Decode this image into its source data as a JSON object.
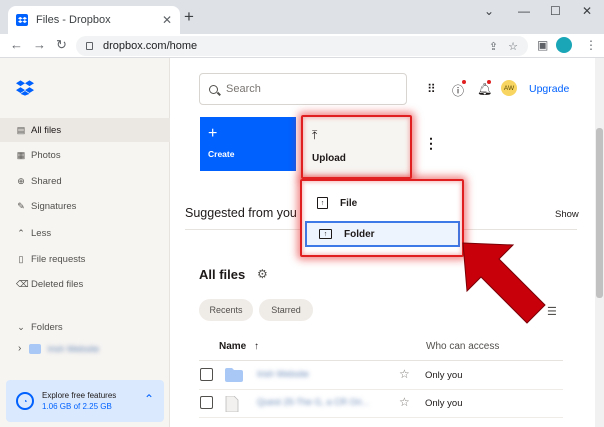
{
  "browser": {
    "tab_title": "Files - Dropbox",
    "tab_close": "✕",
    "new_tab": "+",
    "url": "dropbox.com/home",
    "window_controls": [
      "⌄",
      "—",
      "☐",
      "✕"
    ]
  },
  "sidebar": {
    "items": [
      {
        "label": "All files",
        "icon": "files-icon",
        "glyph": "▤"
      },
      {
        "label": "Photos",
        "icon": "photos-icon",
        "glyph": "▦"
      },
      {
        "label": "Shared",
        "icon": "shared-icon",
        "glyph": "⊕"
      },
      {
        "label": "Signatures",
        "icon": "signatures-icon",
        "glyph": "✎"
      },
      {
        "label": "Less",
        "icon": "chevron-up-icon",
        "glyph": "⌃"
      },
      {
        "label": "File requests",
        "icon": "file-requests-icon",
        "glyph": "▯"
      },
      {
        "label": "Deleted files",
        "icon": "trash-icon",
        "glyph": "⌫"
      }
    ],
    "folders_label": "Folders",
    "folders_chevron": "⌄",
    "folder_sub": "Irish Website",
    "storage": {
      "title": "Explore free features",
      "usage": "1.06 GB of 2.25 GB"
    }
  },
  "header": {
    "search_placeholder": "Search",
    "avatar_initials": "AW",
    "upgrade": "Upgrade"
  },
  "actions": {
    "create": "Create",
    "upload": "Upload",
    "menu": {
      "file": "File",
      "folder": "Folder"
    }
  },
  "suggested": {
    "title": "Suggested from you",
    "show": "Show"
  },
  "files": {
    "title": "All files",
    "filters": [
      "Recents",
      "Starred"
    ],
    "col_name": "Name",
    "sort_arrow": "↑",
    "col_access": "Who can access",
    "rows": [
      {
        "name": "Irish Website",
        "access": "Only you",
        "kind": "folder"
      },
      {
        "name": "Quest 25-The G, a CR Ori...",
        "access": "Only you",
        "kind": "file"
      }
    ]
  },
  "colors": {
    "brand_blue": "#0061fe",
    "highlight_red": "#e02020",
    "arrow_red": "#c8000a",
    "sidebar_bg": "#f7f5f2"
  }
}
